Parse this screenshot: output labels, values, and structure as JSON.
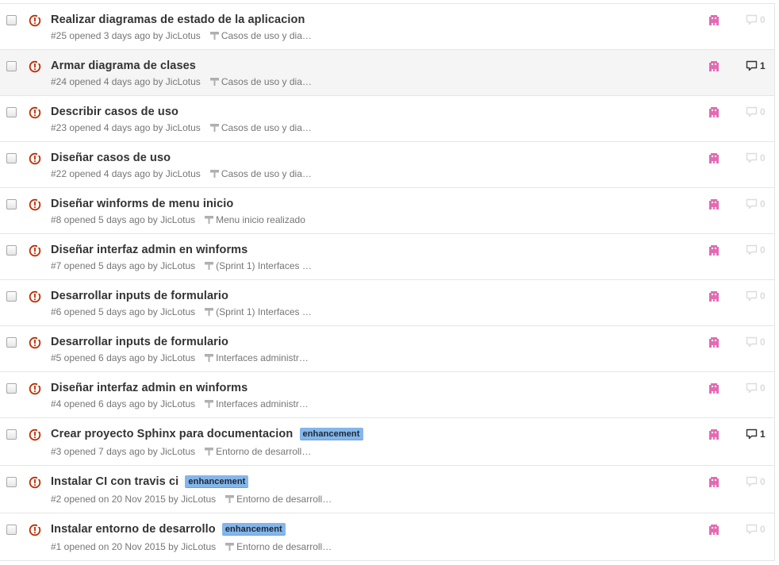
{
  "issues": [
    {
      "title": "Realizar diagramas de estado de la aplicacion",
      "label": "",
      "meta": "#25 opened 3 days ago by JicLotus",
      "milestone": "Casos de uso y dia…",
      "comments": "0",
      "has_comments": false
    },
    {
      "title": "Armar diagrama de clases",
      "label": "",
      "meta": "#24 opened 4 days ago by JicLotus",
      "milestone": "Casos de uso y dia…",
      "comments": "1",
      "has_comments": true
    },
    {
      "title": "Describir casos de uso",
      "label": "",
      "meta": "#23 opened 4 days ago by JicLotus",
      "milestone": "Casos de uso y dia…",
      "comments": "0",
      "has_comments": false
    },
    {
      "title": "Diseñar casos de uso",
      "label": "",
      "meta": "#22 opened 4 days ago by JicLotus",
      "milestone": "Casos de uso y dia…",
      "comments": "0",
      "has_comments": false
    },
    {
      "title": "Diseñar winforms de menu inicio",
      "label": "",
      "meta": "#8 opened 5 days ago by JicLotus",
      "milestone": "Menu inicio realizado",
      "comments": "0",
      "has_comments": false
    },
    {
      "title": "Diseñar interfaz admin en winforms",
      "label": "",
      "meta": "#7 opened 5 days ago by JicLotus",
      "milestone": "(Sprint 1) Interfaces …",
      "comments": "0",
      "has_comments": false
    },
    {
      "title": "Desarrollar inputs de formulario",
      "label": "",
      "meta": "#6 opened 5 days ago by JicLotus",
      "milestone": "(Sprint 1) Interfaces …",
      "comments": "0",
      "has_comments": false
    },
    {
      "title": "Desarrollar inputs de formulario",
      "label": "",
      "meta": "#5 opened 6 days ago by JicLotus",
      "milestone": "Interfaces administr…",
      "comments": "0",
      "has_comments": false
    },
    {
      "title": "Diseñar interfaz admin en winforms",
      "label": "",
      "meta": "#4 opened 6 days ago by JicLotus",
      "milestone": "Interfaces administr…",
      "comments": "0",
      "has_comments": false
    },
    {
      "title": "Crear proyecto Sphinx para documentacion",
      "label": "enhancement",
      "meta": "#3 opened 7 days ago by JicLotus",
      "milestone": "Entorno de desarroll…",
      "comments": "1",
      "has_comments": true
    },
    {
      "title": "Instalar CI con travis ci",
      "label": "enhancement",
      "meta": "#2 opened on 20 Nov 2015 by JicLotus",
      "milestone": "Entorno de desarroll…",
      "comments": "0",
      "has_comments": false
    },
    {
      "title": "Instalar entorno de desarrollo",
      "label": "enhancement",
      "meta": "#1 opened on 20 Nov 2015 by JicLotus",
      "milestone": "Entorno de desarroll…",
      "comments": "0",
      "has_comments": false
    }
  ],
  "icons": {
    "state": "issue-opened-icon",
    "milestone": "milestone-icon",
    "avatar": "avatar-icon",
    "comment": "comment-icon"
  },
  "colors": {
    "state": "#bd2c00",
    "label_bg": "#84b6eb",
    "avatar": "#e36bb4",
    "row_highlight": "#f5f5f5"
  }
}
